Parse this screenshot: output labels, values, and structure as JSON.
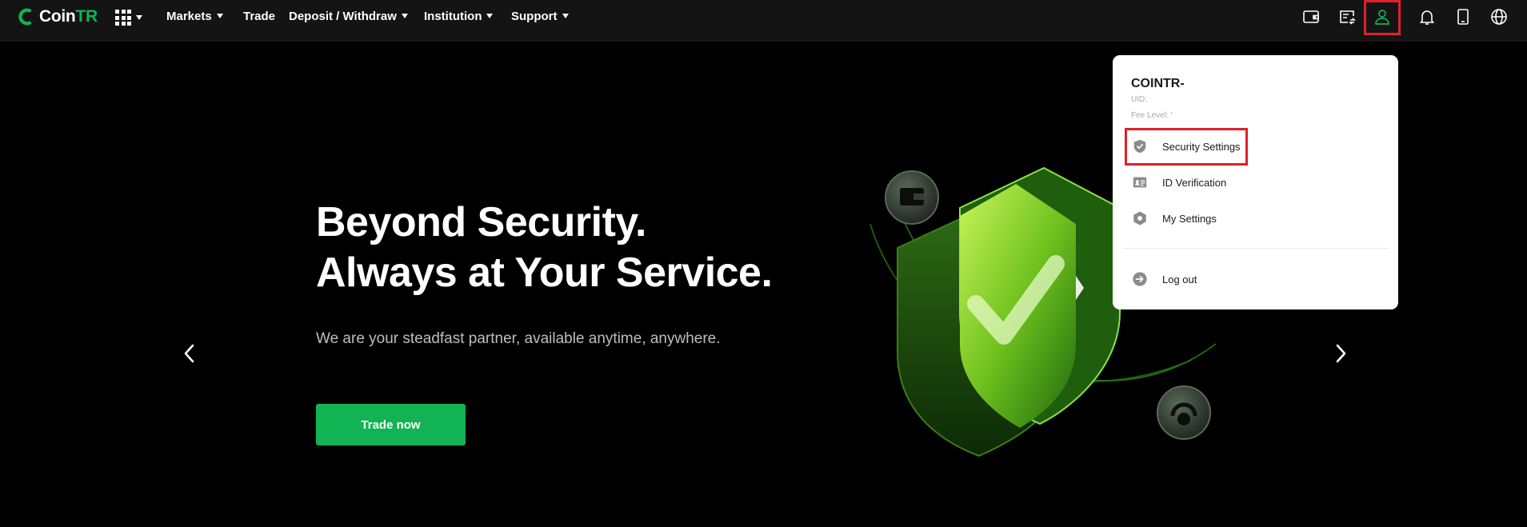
{
  "header": {
    "logo_text_coin": "Coin",
    "logo_text_tr": "TR",
    "nav": [
      {
        "label": "Markets",
        "has_dropdown": true
      },
      {
        "label": "Trade",
        "has_dropdown": false
      },
      {
        "label": "Deposit / Withdraw",
        "has_dropdown": true
      },
      {
        "label": "Institution",
        "has_dropdown": true
      },
      {
        "label": "Support",
        "has_dropdown": true
      }
    ],
    "right_icons": [
      "wallet-icon",
      "orders-icon",
      "user-icon",
      "bell-icon",
      "mobile-icon",
      "globe-icon"
    ]
  },
  "hero": {
    "title_line1": "Beyond Security.",
    "title_line2": "Always at Your Service.",
    "subtitle": "We are your steadfast partner, available anytime, anywhere.",
    "cta_label": "Trade now"
  },
  "account_menu": {
    "name": "COINTR-",
    "uid_label": "UID:",
    "fee_level_label": "Fee Level: '",
    "items": [
      {
        "label": "Security Settings",
        "icon": "shield-check-icon"
      },
      {
        "label": "ID Verification",
        "icon": "id-card-icon"
      },
      {
        "label": "My Settings",
        "icon": "settings-hex-icon"
      },
      {
        "label": "Log out",
        "icon": "logout-icon"
      }
    ]
  },
  "colors": {
    "brand_green": "#12b353",
    "highlight_red": "#e0202a",
    "topbar_bg": "#141414"
  }
}
